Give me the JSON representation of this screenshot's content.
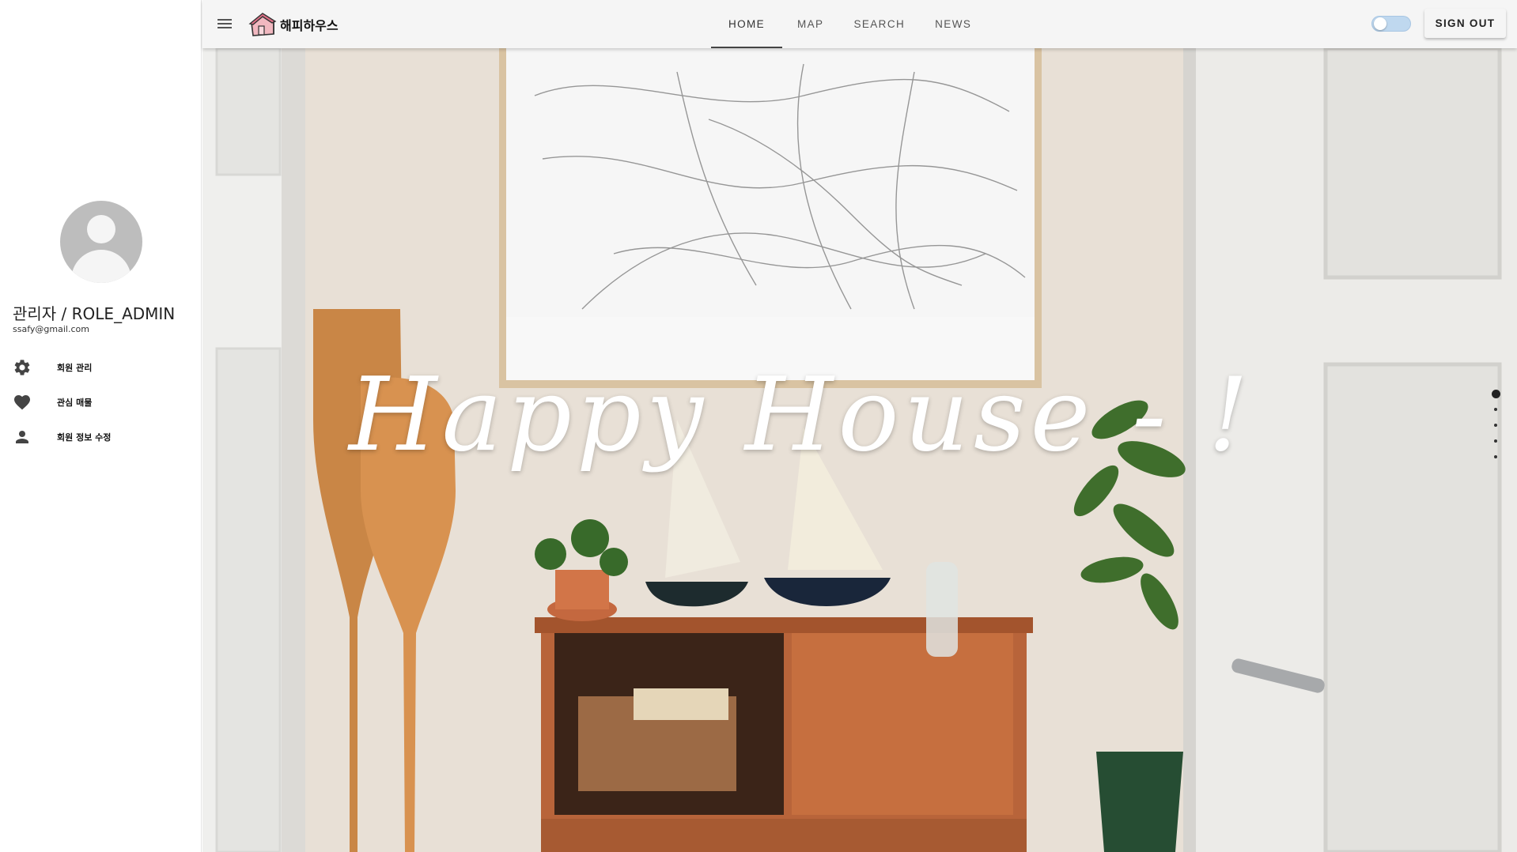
{
  "sidebar": {
    "user_name": "관리자 / ROLE_ADMIN",
    "user_email": "ssafy@gmail.com",
    "items": [
      {
        "label": "회원 관리",
        "icon": "gear-icon"
      },
      {
        "label": "관심 매물",
        "icon": "heart-icon"
      },
      {
        "label": "회원 정보 수정",
        "icon": "person-icon"
      }
    ]
  },
  "appbar": {
    "logo_text": "해피하우스",
    "tabs": [
      "HOME",
      "MAP",
      "SEARCH",
      "NEWS"
    ],
    "active_tab": "HOME",
    "signout_label": "SIGN OUT",
    "theme_toggle_on": false
  },
  "hero": {
    "title": "Happy House - !",
    "slide_count": 5,
    "active_slide": 1
  },
  "colors": {
    "appbar_bg": "#f5f5f5",
    "avatar_bg": "#bdbdbd",
    "icon_color": "#444444",
    "toggle_track": "#bfd8ef"
  }
}
